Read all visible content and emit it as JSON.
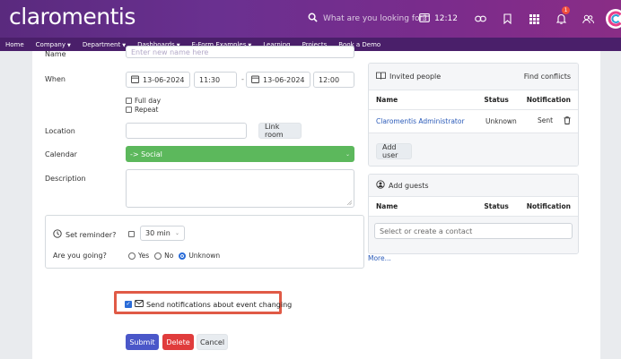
{
  "header": {
    "logo": "claromentis",
    "search_placeholder": "What are you looking for?",
    "time": "12:12",
    "notification_count": "1",
    "icons": [
      "search-icon",
      "calendar-icon",
      "link-icon",
      "bookmark-icon",
      "apps-grid-icon",
      "bell-icon",
      "people-icon",
      "brand-logo-icon"
    ]
  },
  "nav": {
    "items": [
      "Home",
      "Company",
      "Department",
      "Dashboards",
      "E-Form Examples",
      "Learning",
      "Projects",
      "Book a Demo"
    ],
    "has_caret": [
      false,
      true,
      true,
      true,
      true,
      false,
      false,
      false
    ]
  },
  "form": {
    "name_label": "Name",
    "name_placeholder": "Enter new name here",
    "when_label": "When",
    "start_date": "13-06-2024",
    "start_time": "11:30",
    "range_sep": "-",
    "end_date": "13-06-2024",
    "end_time": "12:00",
    "full_day_label": "Full day",
    "repeat_label": "Repeat",
    "location_label": "Location",
    "location_value": "",
    "link_room_label": "Link room",
    "calendar_label": "Calendar",
    "calendar_value": "-> Social",
    "calendar_color": "#5cb85c",
    "description_label": "Description",
    "description_value": "",
    "reminder_label": "Set reminder?",
    "reminder_value": "30 min",
    "going_label": "Are you going?",
    "going_options": [
      "Yes",
      "No",
      "Unknown"
    ],
    "going_selected": "Unknown",
    "notify_label": "Send notifications about event changing",
    "notify_checked": true,
    "submit_label": "Submit",
    "delete_label": "Delete",
    "cancel_label": "Cancel"
  },
  "invited": {
    "title": "Invited people",
    "find_conflicts": "Find conflicts",
    "columns": [
      "Name",
      "Status",
      "Notification"
    ],
    "rows": [
      {
        "name": "Claromentis Administrator",
        "status": "Unknown",
        "notification": "Sent"
      }
    ],
    "add_user_label": "Add user"
  },
  "guests": {
    "title": "Add guests",
    "columns": [
      "Name",
      "Status",
      "Notification"
    ],
    "contact_placeholder": "Select or create a contact"
  },
  "more_link": "More...",
  "colors": {
    "header_purple": "#6a3090",
    "nav_purple": "#4a1f6a",
    "submit_blue": "#4a57c9",
    "delete_red": "#e03c3c",
    "highlight": "#e05a46"
  }
}
